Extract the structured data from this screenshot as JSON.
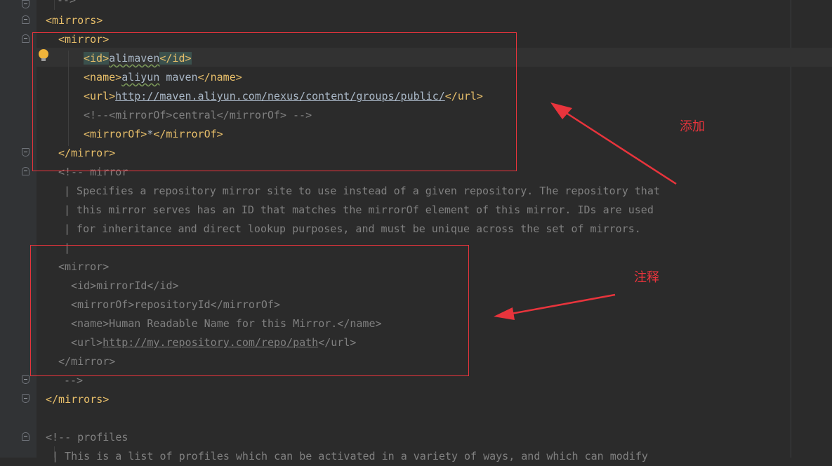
{
  "editor": {
    "lines": [
      {
        "k": "comment_end_top",
        "parts": [
          {
            "c": "cmt",
            "t": "-->"
          }
        ]
      },
      {
        "k": "mirrors_open",
        "parts": [
          {
            "c": "tag",
            "t": "<mirrors>"
          }
        ]
      },
      {
        "k": "mirror_open",
        "parts": [
          {
            "c": "tag",
            "t": "<mirror>"
          }
        ]
      },
      {
        "k": "id_line",
        "parts": [
          {
            "c": "tag hl",
            "t": "<id>"
          },
          {
            "c": "txt squig",
            "t": "alimaven"
          },
          {
            "c": "tag hl",
            "t": "</id>"
          }
        ]
      },
      {
        "k": "name_line",
        "parts": [
          {
            "c": "tag",
            "t": "<name>"
          },
          {
            "c": "txt squig",
            "t": "aliyun"
          },
          {
            "c": "txt",
            "t": " maven"
          },
          {
            "c": "tag",
            "t": "</name>"
          }
        ]
      },
      {
        "k": "url_line",
        "parts": [
          {
            "c": "tag",
            "t": "<url>"
          },
          {
            "c": "url",
            "t": "http://maven.aliyun.com/nexus/content/groups/public/"
          },
          {
            "c": "tag",
            "t": "</url>"
          }
        ]
      },
      {
        "k": "mirrorof_comment",
        "parts": [
          {
            "c": "cmt",
            "t": "<!--<mirrorOf>central</mirrorOf> -->"
          }
        ]
      },
      {
        "k": "mirrorof_line",
        "parts": [
          {
            "c": "tag",
            "t": "<mirrorOf>"
          },
          {
            "c": "txt",
            "t": "*"
          },
          {
            "c": "tag",
            "t": "</mirrorOf>"
          }
        ]
      },
      {
        "k": "mirror_close",
        "parts": [
          {
            "c": "tag",
            "t": "</mirror>"
          }
        ]
      },
      {
        "k": "c_mirror",
        "parts": [
          {
            "c": "cmt",
            "t": "<!-- mirror"
          }
        ]
      },
      {
        "k": "c_line1",
        "parts": [
          {
            "c": "cmt",
            "t": "| Specifies a repository mirror site to use instead of a given repository. The repository that"
          }
        ]
      },
      {
        "k": "c_line2",
        "parts": [
          {
            "c": "cmt",
            "t": "| this mirror serves has an ID that matches the mirrorOf element of this mirror. IDs are used"
          }
        ]
      },
      {
        "k": "c_line3",
        "parts": [
          {
            "c": "cmt",
            "t": "| for inheritance and direct lookup purposes, and must be unique across the set of mirrors."
          }
        ]
      },
      {
        "k": "c_bar",
        "parts": [
          {
            "c": "cmt",
            "t": "|"
          }
        ]
      },
      {
        "k": "c_mirror_open",
        "parts": [
          {
            "c": "cmt",
            "t": "<mirror>"
          }
        ]
      },
      {
        "k": "c_id",
        "parts": [
          {
            "c": "cmt",
            "t": "<id>mirrorId</id>"
          }
        ]
      },
      {
        "k": "c_mirrorof",
        "parts": [
          {
            "c": "cmt",
            "t": "<mirrorOf>repositoryId</mirrorOf>"
          }
        ]
      },
      {
        "k": "c_name",
        "parts": [
          {
            "c": "cmt",
            "t": "<name>Human Readable Name for this Mirror.</name>"
          }
        ]
      },
      {
        "k": "c_url",
        "parts": [
          {
            "c": "cmt",
            "t": "<url>"
          },
          {
            "c": "cmt url",
            "t": "http://my.repository.com/repo/path"
          },
          {
            "c": "cmt",
            "t": "</url>"
          }
        ]
      },
      {
        "k": "c_mirror_close",
        "parts": [
          {
            "c": "cmt",
            "t": "</mirror>"
          }
        ]
      },
      {
        "k": "c_end",
        "parts": [
          {
            "c": "cmt",
            "t": "-->"
          }
        ]
      },
      {
        "k": "mirrors_close",
        "parts": [
          {
            "c": "tag",
            "t": "</mirrors>"
          }
        ]
      },
      {
        "k": "blank",
        "parts": []
      },
      {
        "k": "profiles_comment",
        "parts": [
          {
            "c": "cmt",
            "t": "<!-- profiles"
          }
        ]
      },
      {
        "k": "profiles_line1",
        "parts": [
          {
            "c": "cmt",
            "t": "| This is a list of profiles which can be activated in a variety of ways, and which can modify"
          }
        ]
      }
    ]
  },
  "annotations": {
    "added_label": "添加",
    "comment_label": "注释"
  },
  "colors": {
    "background": "#2b2b2b",
    "tag": "#e8bf6a",
    "comment": "#808080",
    "annotation": "#e8343c"
  },
  "icons": [
    "intention-bulb-icon",
    "fold-marker-icon"
  ]
}
